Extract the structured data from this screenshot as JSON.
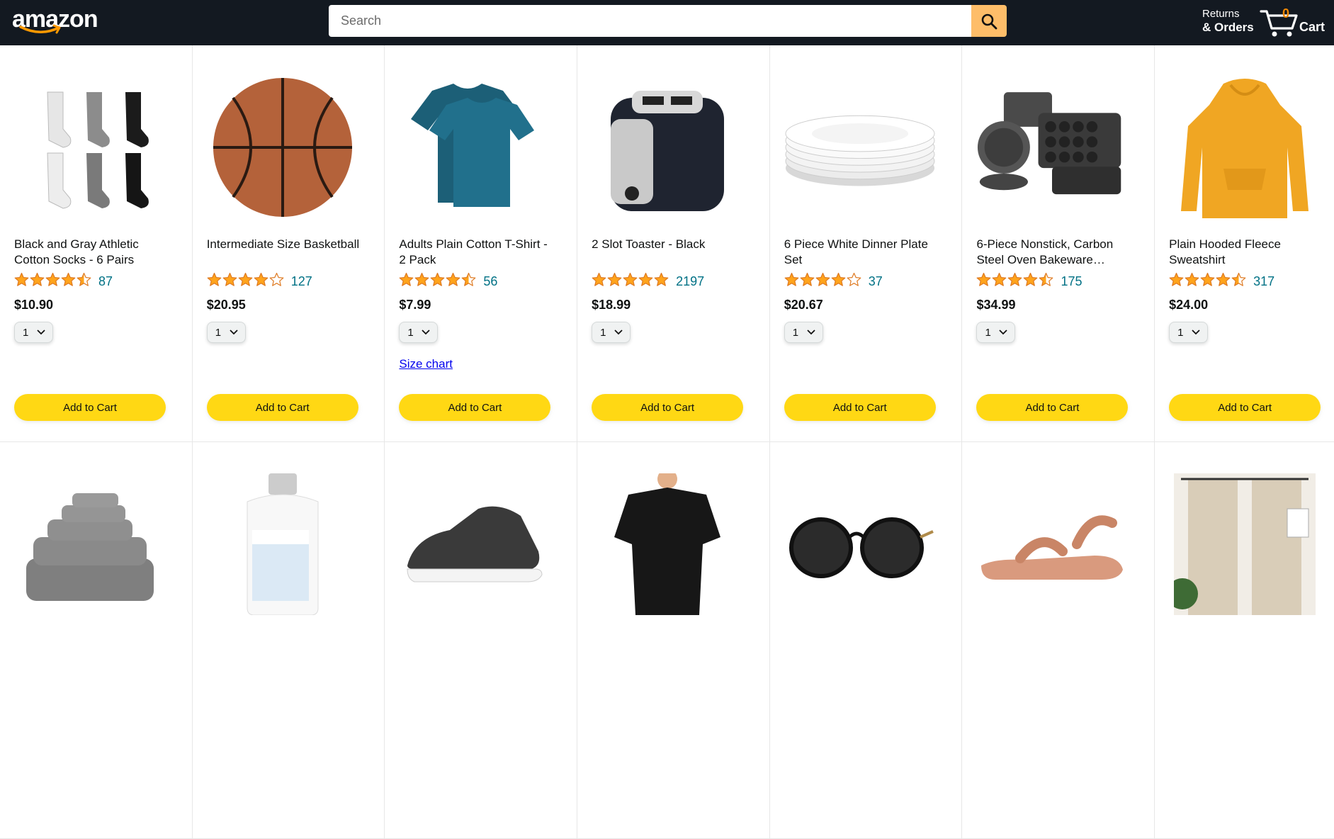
{
  "header": {
    "logo_text": "amazon",
    "search_placeholder": "Search",
    "returns_line1": "Returns",
    "returns_line2": "& Orders",
    "cart_count": "0",
    "cart_label": "Cart"
  },
  "colors": {
    "header_bg": "#131921",
    "search_button": "#febd69",
    "add_button": "#ffd814",
    "star": "#ffa41c",
    "rating_link": "#007185",
    "cart_count": "#f08804"
  },
  "products": [
    {
      "name": "Black and Gray Athletic Cotton Socks - 6 Pairs",
      "rating": 4.5,
      "count": "87",
      "price": "$10.90",
      "qty": "1",
      "image": "socks",
      "button": "Add to Cart"
    },
    {
      "name": "Intermediate Size Basketball",
      "rating": 4.0,
      "count": "127",
      "price": "$20.95",
      "qty": "1",
      "image": "basketball",
      "button": "Add to Cart"
    },
    {
      "name": "Adults Plain Cotton T-Shirt - 2 Pack",
      "rating": 4.5,
      "count": "56",
      "price": "$7.99",
      "qty": "1",
      "image": "tshirt",
      "button": "Add to Cart",
      "extra_link": "Size chart"
    },
    {
      "name": "2 Slot Toaster - Black",
      "rating": 5.0,
      "count": "2197",
      "price": "$18.99",
      "qty": "1",
      "image": "toaster",
      "button": "Add to Cart"
    },
    {
      "name": "6 Piece White Dinner Plate Set",
      "rating": 4.0,
      "count": "37",
      "price": "$20.67",
      "qty": "1",
      "image": "plates",
      "button": "Add to Cart"
    },
    {
      "name": "6-Piece Nonstick, Carbon Steel Oven Bakeware…",
      "rating": 4.5,
      "count": "175",
      "price": "$34.99",
      "qty": "1",
      "image": "bakeware",
      "button": "Add to Cart"
    },
    {
      "name": "Plain Hooded Fleece Sweatshirt",
      "rating": 4.5,
      "count": "317",
      "price": "$24.00",
      "qty": "1",
      "image": "hoodie",
      "button": "Add to Cart"
    }
  ],
  "row2_images": [
    "towels",
    "detergent",
    "sneaker",
    "beach-dress",
    "sunglasses",
    "sandal",
    "curtains"
  ]
}
